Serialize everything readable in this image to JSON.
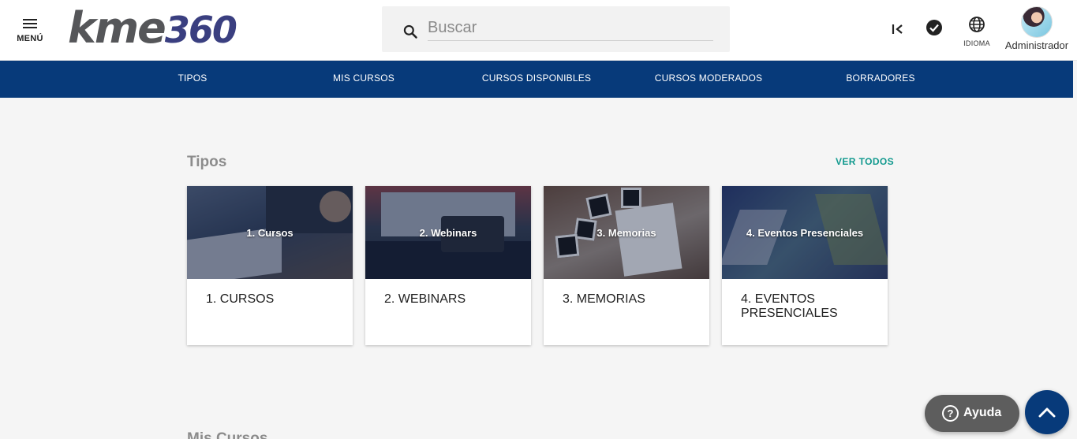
{
  "header": {
    "menu_label": "MENÚ",
    "logo_text_a": "kme",
    "logo_text_b": "360",
    "search_placeholder": "Buscar",
    "language_label": "IDIOMA",
    "user_name": "Administrador"
  },
  "nav": {
    "items": [
      {
        "label": "TIPOS"
      },
      {
        "label": "MIS CURSOS"
      },
      {
        "label": "CURSOS DISPONIBLES"
      },
      {
        "label": "CURSOS MODERADOS"
      },
      {
        "label": "BORRADORES"
      }
    ]
  },
  "section": {
    "title": "Tipos",
    "see_all": "VER TODOS",
    "cards": [
      {
        "image_text": "1. Cursos",
        "label": "1. CURSOS"
      },
      {
        "image_text": "2. Webinars",
        "label": "2. WEBINARS"
      },
      {
        "image_text": "3. Memorias",
        "label": "3. MEMORIAS"
      },
      {
        "image_text": "4. Eventos Presenciales",
        "label": "4. EVENTOS PRESENCIALES"
      }
    ]
  },
  "next_section": {
    "title": "Mis Cursos"
  },
  "help": {
    "label": "Ayuda"
  },
  "colors": {
    "nav_bg": "#073a7a",
    "accent": "#11998e",
    "logo_gray": "#555659",
    "logo_blue": "#3a3f80"
  }
}
